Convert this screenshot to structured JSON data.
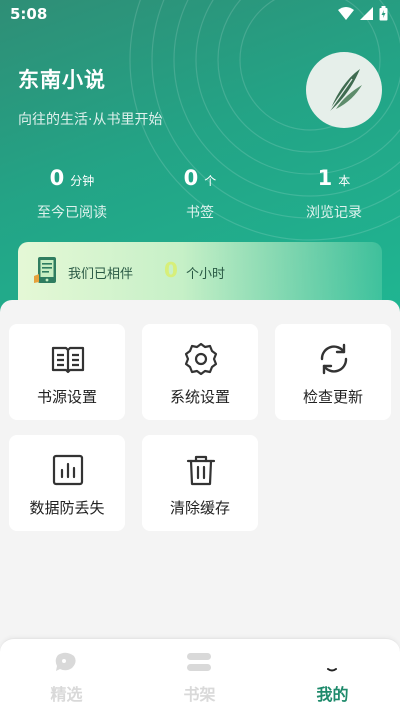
{
  "status_bar": {
    "time": "5:08"
  },
  "app": {
    "title": "东南小说",
    "subtitle": "向往的生活·从书里开始"
  },
  "stats": [
    {
      "value": "0",
      "unit": "分钟",
      "label": "至今已阅读"
    },
    {
      "value": "0",
      "unit": "个",
      "label": "书签"
    },
    {
      "value": "1",
      "unit": "本",
      "label": "浏览记录"
    }
  ],
  "banner": {
    "text": "我们已相伴",
    "value": "0",
    "unit": "个小时"
  },
  "menu": [
    {
      "label": "书源设置",
      "icon": "book-open-icon"
    },
    {
      "label": "系统设置",
      "icon": "gear-icon"
    },
    {
      "label": "检查更新",
      "icon": "refresh-icon"
    },
    {
      "label": "数据防丢失",
      "icon": "bar-chart-icon"
    },
    {
      "label": "清除缓存",
      "icon": "trash-icon"
    }
  ],
  "tabs": [
    {
      "label": "精选",
      "icon": "featured-icon",
      "active": false
    },
    {
      "label": "书架",
      "icon": "bookshelf-icon",
      "active": false
    },
    {
      "label": "我的",
      "icon": "profile-icon",
      "active": true
    }
  ],
  "colors": {
    "primary": "#23a486",
    "active_tab": "#1e8a6b",
    "inactive_tab": "#d9d9d9",
    "banner_number": "#d7ef7a"
  }
}
